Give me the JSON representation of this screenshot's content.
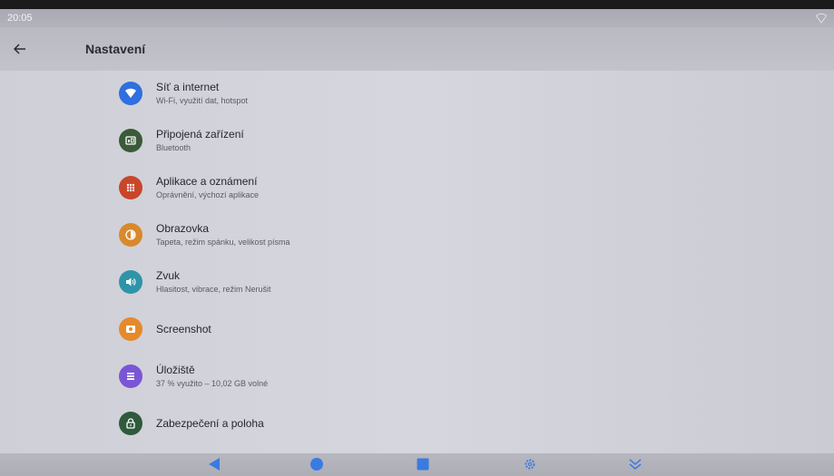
{
  "status": {
    "time": "20:05"
  },
  "appbar": {
    "title": "Nastavení"
  },
  "items": [
    {
      "label": "Síť a internet",
      "sub": "Wi-Fi, využití dat, hotspot",
      "icon": "wifi-icon",
      "color": "#2f6fe0"
    },
    {
      "label": "Připojená zařízení",
      "sub": "Bluetooth",
      "icon": "connected-devices-icon",
      "color": "#3b5a3a"
    },
    {
      "label": "Aplikace a oznámení",
      "sub": "Oprávnění, výchozí aplikace",
      "icon": "apps-icon",
      "color": "#c8462a"
    },
    {
      "label": "Obrazovka",
      "sub": "Tapeta, režim spánku, velikost písma",
      "icon": "display-icon",
      "color": "#d9892b"
    },
    {
      "label": "Zvuk",
      "sub": "Hlasitost, vibrace, režim Nerušit",
      "icon": "sound-icon",
      "color": "#2e94a8"
    },
    {
      "label": "Screenshot",
      "sub": "",
      "icon": "screenshot-icon",
      "color": "#e58a2c"
    },
    {
      "label": "Úložiště",
      "sub": "37 % využito – 10,02 GB volné",
      "icon": "storage-icon",
      "color": "#7a56d6"
    },
    {
      "label": "Zabezpečení a poloha",
      "sub": "",
      "icon": "lock-icon",
      "color": "#2f5a3c"
    }
  ],
  "navbar": {
    "buttons": [
      "back-nav-icon",
      "home-nav-icon",
      "recents-nav-icon",
      "settings-nav-icon",
      "collapse-nav-icon"
    ],
    "color": "#3a7be0"
  }
}
